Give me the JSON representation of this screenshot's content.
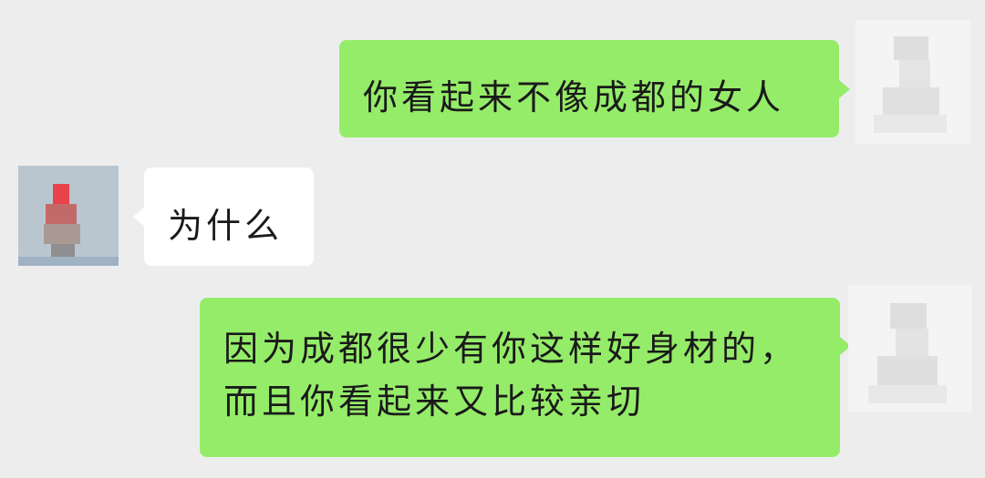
{
  "chat": {
    "messages": [
      {
        "side": "sent",
        "lines": [
          "你看起来不像成都的女人"
        ]
      },
      {
        "side": "received",
        "lines": [
          "为什么"
        ]
      },
      {
        "side": "sent",
        "lines": [
          "因为成都很少有你这样好身材的，",
          "而且你看起来又比较亲切"
        ]
      }
    ]
  },
  "colors": {
    "background": "#ededed",
    "sent_bubble": "#95ec69",
    "received_bubble": "#ffffff",
    "text": "#1a1a1a"
  },
  "icons": {
    "sent_avatar": "blurred-avatar-icon",
    "received_avatar": "blurred-avatar-icon"
  }
}
